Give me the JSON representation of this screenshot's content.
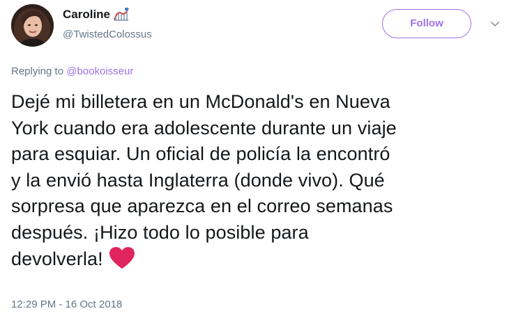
{
  "user": {
    "display_name": "Caroline",
    "handle": "@TwistedColossus",
    "avatar_icon": "profile-photo",
    "name_emoji_icon": "roller-coaster-emoji"
  },
  "actions": {
    "follow_label": "Follow",
    "caret_icon": "chevron-down-icon"
  },
  "reply": {
    "prefix": "Replying to",
    "mention": "@bookoisseur"
  },
  "tweet": {
    "lines": [
      "Dejé mi billetera en un McDonald's en Nueva",
      "York cuando era adolescente durante un viaje",
      "para esquiar. Un oficial de policía la encontró",
      "y la envió hasta Inglaterra (donde vivo). Qué",
      "sorpresa que aparezca en el correo semanas",
      "después. ¡Hizo todo lo posible para",
      "devolverla!"
    ],
    "emoji_icon": "red-heart-emoji"
  },
  "timestamp": "12:29 PM - 16 Oct 2018",
  "colors": {
    "accent": "#9f71e8",
    "secondary_text": "#657786",
    "primary_text": "#14171a",
    "heart": "#e0245e"
  }
}
